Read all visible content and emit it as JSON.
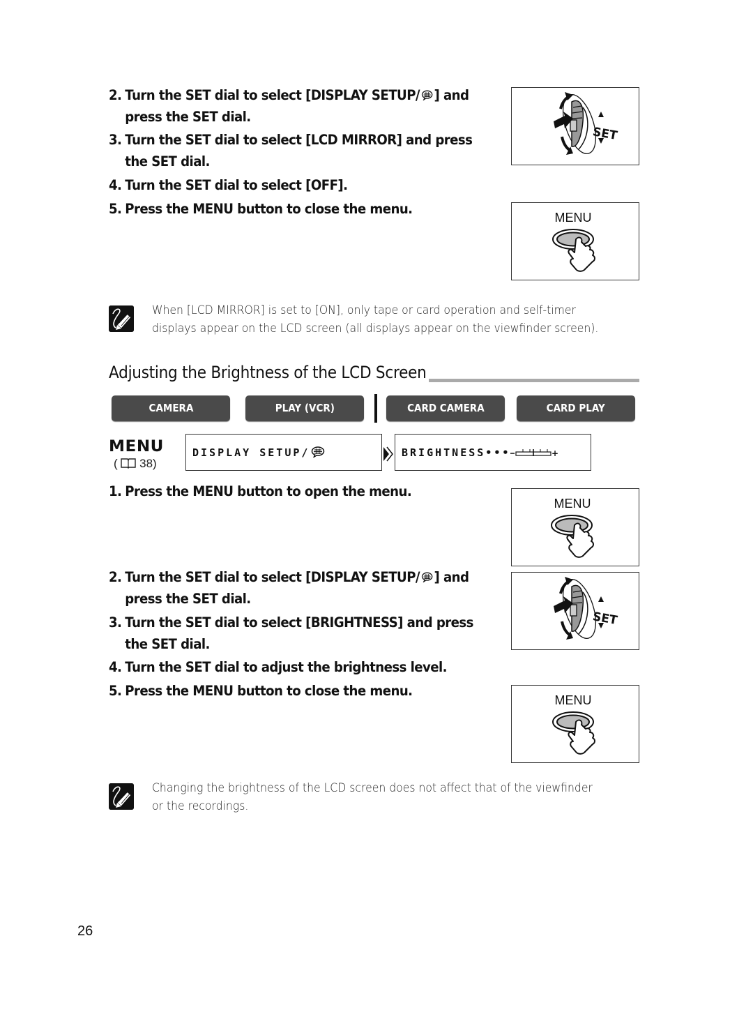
{
  "section1": {
    "steps": [
      {
        "num": "2.",
        "line1_pre": "Turn the SET dial to select [DISPLAY SETUP/",
        "line1_post": "] and",
        "line2": "press the SET dial."
      },
      {
        "num": "3.",
        "line1": "Turn the SET dial to select [LCD MIRROR] and press",
        "line2": "the SET dial."
      },
      {
        "num": "4.",
        "line1": "Turn the SET dial to select [OFF]."
      },
      {
        "num": "5.",
        "line1": "Press the MENU button to close the menu."
      }
    ],
    "figures": {
      "dial_label": "SET",
      "menu_label": "MENU"
    },
    "note": {
      "line1": "When [LCD MIRROR] is set to [ON], only tape or card operation and self-timer",
      "line2": "displays appear on the LCD screen (all displays appear on the viewfinder screen)."
    }
  },
  "section2": {
    "heading": "Adjusting the Brightness of the LCD Screen",
    "modes": [
      "CAMERA",
      "PLAY (VCR)",
      "CARD CAMERA",
      "CARD PLAY"
    ],
    "menu_logo": "MENU",
    "menu_ref_open": "(",
    "menu_ref_page": "38)",
    "lcd_path": [
      {
        "text": "DISPLAY SETUP/"
      },
      {
        "text": "BRIGHTNESS•••"
      }
    ],
    "brightness_level": 0.5,
    "steps": [
      {
        "num": "1.",
        "line1": "Press the MENU button to open the menu."
      },
      {
        "num": "2.",
        "line1_pre": "Turn the SET dial to select [DISPLAY SETUP/",
        "line1_post": "] and",
        "line2": "press the SET dial."
      },
      {
        "num": "3.",
        "line1": "Turn the SET dial to select [BRIGHTNESS] and press",
        "line2": "the SET dial."
      },
      {
        "num": "4.",
        "line1": "Turn the SET dial to adjust the brightness level."
      },
      {
        "num": "5.",
        "line1": "Press the MENU button to close the menu."
      }
    ],
    "figures": {
      "menu_label": "MENU",
      "dial_label": "SET"
    },
    "note": {
      "line1": "Changing the brightness of the LCD screen does not affect that of the viewfinder",
      "line2": "or the recordings."
    }
  },
  "page_number": "26"
}
